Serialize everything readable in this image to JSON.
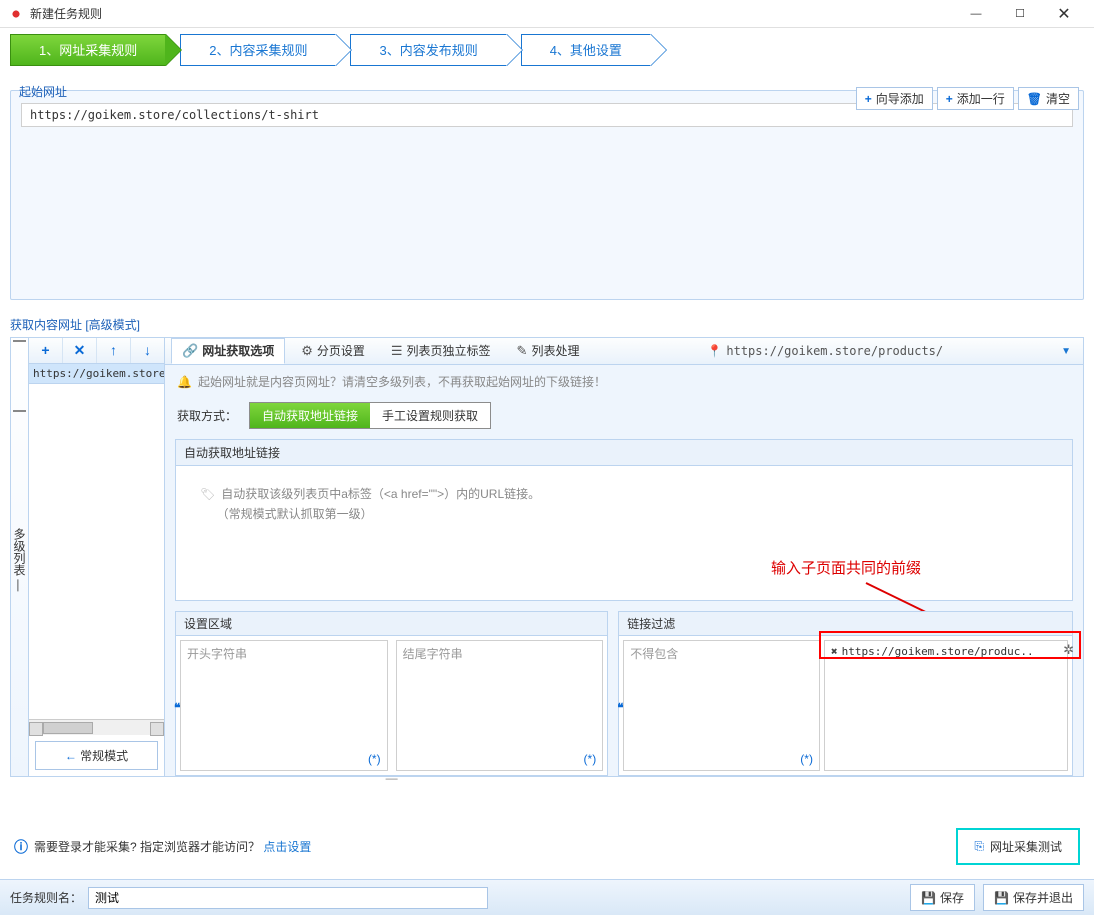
{
  "title": "新建任务规则",
  "wizard_tabs": [
    "1、网址采集规则",
    "2、内容采集规则",
    "3、内容发布规则",
    "4、其他设置"
  ],
  "start_url": {
    "label": "起始网址",
    "toolbar": {
      "guide_add": "向导添加",
      "add_row": "添加一行",
      "clear": "清空"
    },
    "value": "https://goikem.store/collections/t-shirt"
  },
  "get_url_label": "获取内容网址 [高级模式]",
  "left_vert": "多级列表 —",
  "left_list_item": "https://goikem.store/",
  "normal_mode_btn": "常规模式",
  "sub_tabs": {
    "opts": "网址获取选项",
    "paging": "分页设置",
    "list_tags": "列表页独立标签",
    "list_proc": "列表处理"
  },
  "url_path": "https://goikem.store/products/",
  "hint": "起始网址就是内容页网址？请清空多级列表，不再获取起始网址的下级链接！",
  "mode_label": "获取方式：",
  "mode_btns": {
    "auto": "自动获取地址链接",
    "manual": "手工设置规则获取"
  },
  "auto_group": {
    "header": "自动获取地址链接",
    "line1": "自动获取该级列表页中a标签（<a href=\"\">）内的URL链接。",
    "line2": "（常规模式默认抓取第一级）"
  },
  "annotation": "输入子页面共同的前缀",
  "setting_area": {
    "header": "设置区域",
    "start": "开头字符串",
    "end": "结尾字符串"
  },
  "link_filter": {
    "header": "链接过滤",
    "not_contain": "不得包含",
    "item": "https://goikem.store/produc.."
  },
  "footer": {
    "login_msg_a": "需要登录才能采集? 指定浏览器才能访问？",
    "login_link": "点击设置",
    "test_btn": "网址采集测试",
    "rule_label": "任务规则名：",
    "rule_value": "测试",
    "save": "保存",
    "save_exit": "保存并退出"
  }
}
